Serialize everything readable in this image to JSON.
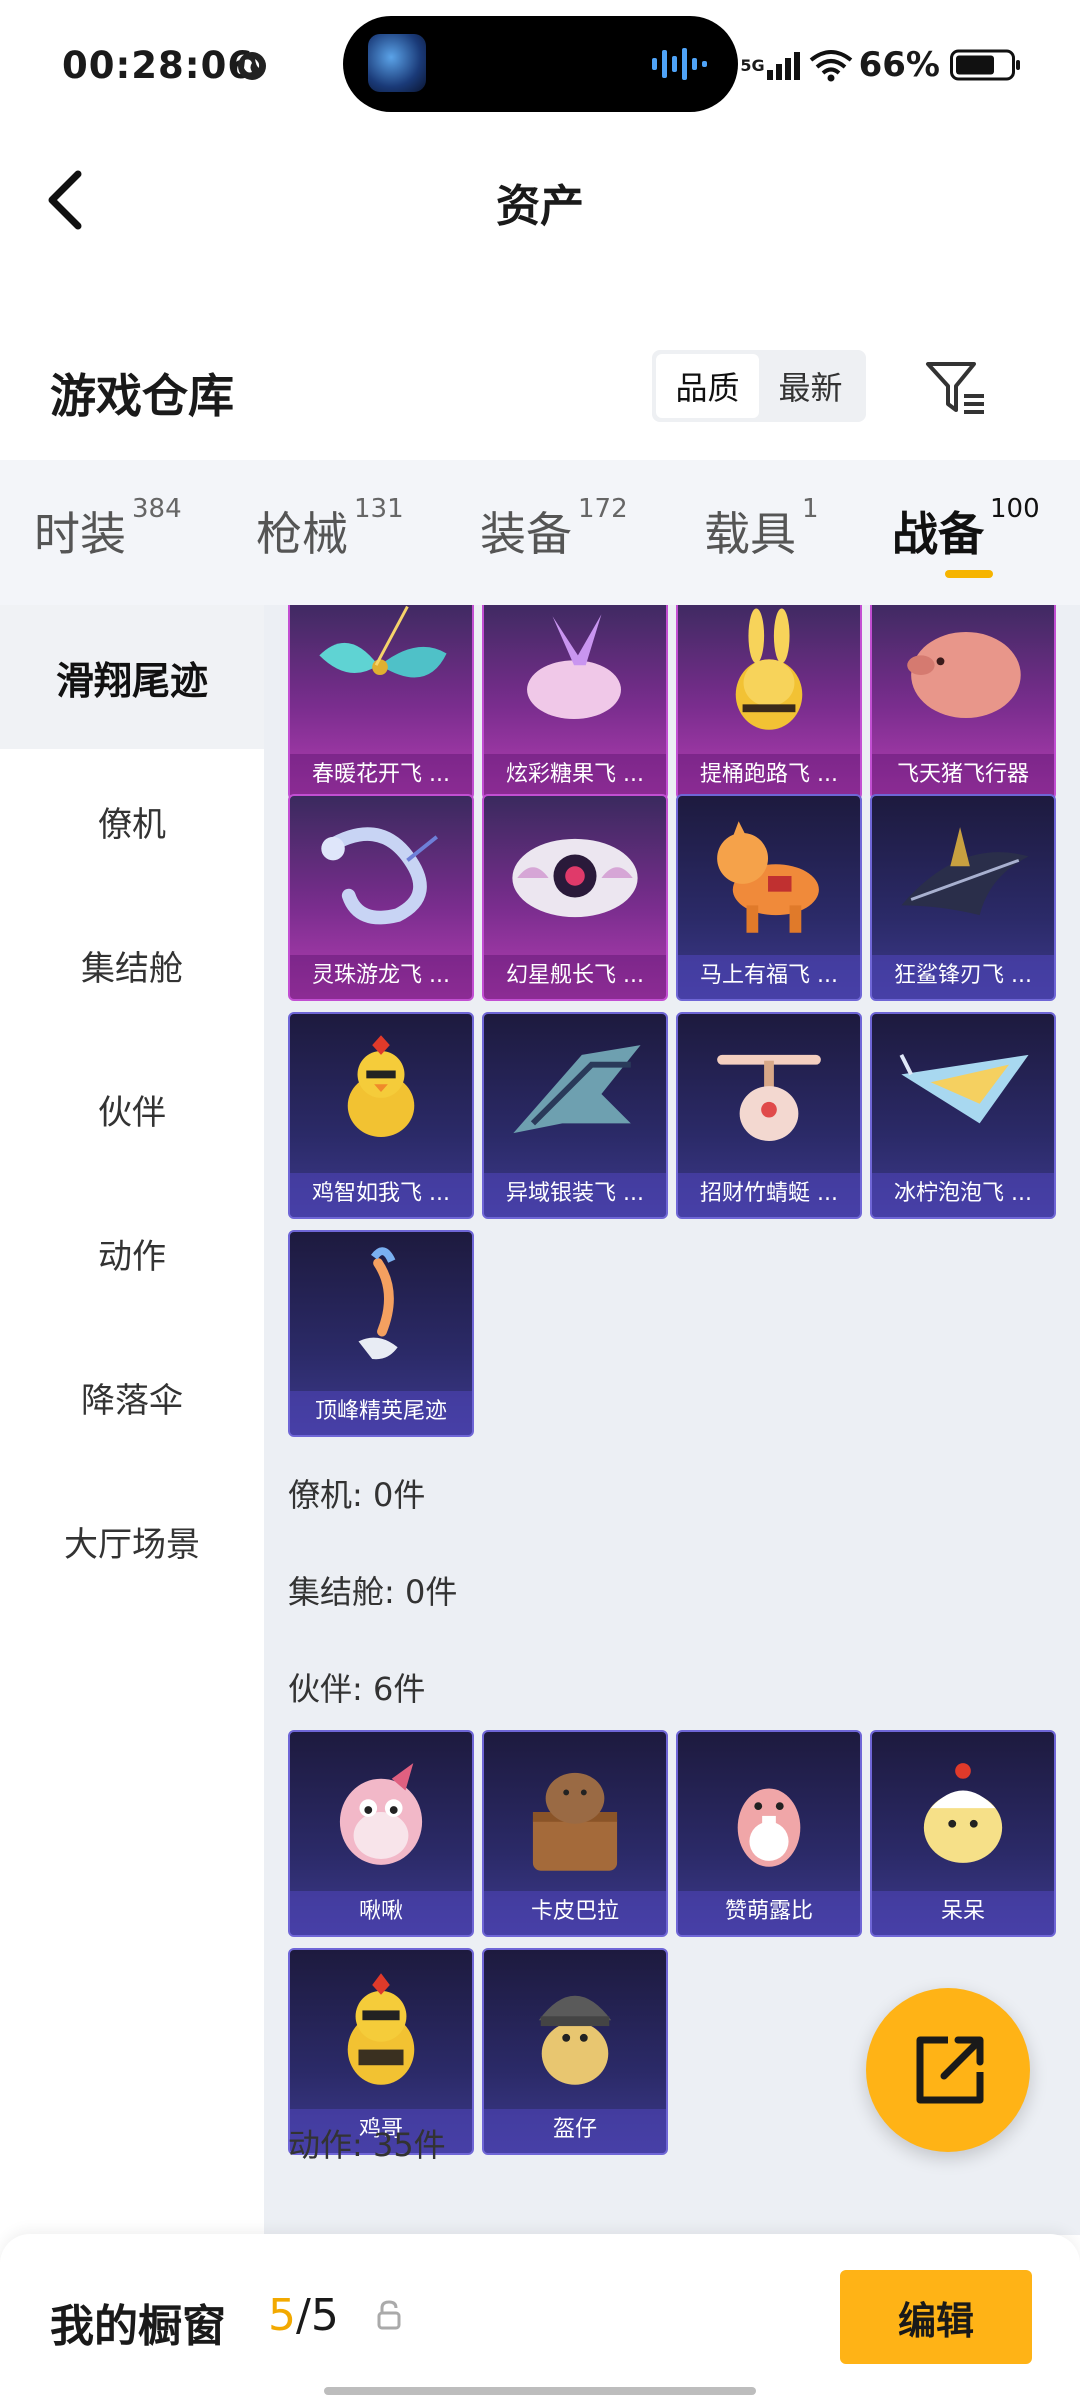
{
  "status_bar": {
    "time": "00:28:06",
    "network": "5G",
    "battery": "66%"
  },
  "header": {
    "title": "资产"
  },
  "warehouse": {
    "title": "游戏仓库",
    "sort_options": [
      "品质",
      "最新"
    ],
    "active_sort": "品质"
  },
  "tabs": [
    {
      "label": "时装",
      "count": "384"
    },
    {
      "label": "枪械",
      "count": "131"
    },
    {
      "label": "装备",
      "count": "172"
    },
    {
      "label": "载具",
      "count": "1"
    },
    {
      "label": "战备",
      "count": "100"
    }
  ],
  "active_tab": "战备",
  "sidebar": {
    "items": [
      "滑翔尾迹",
      "僚机",
      "集结舱",
      "伙伴",
      "动作",
      "降落伞",
      "大厅场景"
    ],
    "active": "滑翔尾迹"
  },
  "glide_trails": {
    "items": [
      {
        "name": "春暖花开飞 ...",
        "rarity": "purple"
      },
      {
        "name": "炫彩糖果飞 ...",
        "rarity": "purple"
      },
      {
        "name": "提桶跑路飞 ...",
        "rarity": "purple"
      },
      {
        "name": "飞天猪飞行器",
        "rarity": "purple"
      },
      {
        "name": "灵珠游龙飞 ...",
        "rarity": "purple"
      },
      {
        "name": "幻星舰长飞 ...",
        "rarity": "purple"
      },
      {
        "name": "马上有福飞 ...",
        "rarity": "blue"
      },
      {
        "name": "狂鲨锋刃飞 ...",
        "rarity": "blue"
      },
      {
        "name": "鸡智如我飞 ...",
        "rarity": "blue"
      },
      {
        "name": "异域银装飞 ...",
        "rarity": "blue"
      },
      {
        "name": "招财竹蜻蜓 ...",
        "rarity": "blue"
      },
      {
        "name": "冰柠泡泡飞 ...",
        "rarity": "blue"
      },
      {
        "name": "顶峰精英尾迹",
        "rarity": "blue"
      }
    ]
  },
  "sections": {
    "wingman": "僚机: 0件",
    "pod": "集结舱: 0件",
    "companion": "伙伴: 6件",
    "emote": "动作: 35件"
  },
  "companions": {
    "items": [
      {
        "name": "啾啾",
        "rarity": "blue"
      },
      {
        "name": "卡皮巴拉",
        "rarity": "blue"
      },
      {
        "name": "赞萌露比",
        "rarity": "blue"
      },
      {
        "name": "呆呆",
        "rarity": "blue"
      },
      {
        "name": "鸡哥",
        "rarity": "blue"
      },
      {
        "name": "盔仔",
        "rarity": "blue"
      }
    ]
  },
  "bottom_bar": {
    "label": "我的橱窗",
    "used": "5",
    "total": "/5",
    "edit_label": "编辑"
  },
  "colors": {
    "accent": "#ffb316",
    "purple_rarity": "#b53fb3",
    "blue_rarity": "#3d3a8c"
  },
  "icons": [
    "globe-icon",
    "signal-icon",
    "wifi-icon",
    "battery-icon",
    "back-arrow-icon",
    "filter-icon",
    "share-icon",
    "lock-icon"
  ]
}
